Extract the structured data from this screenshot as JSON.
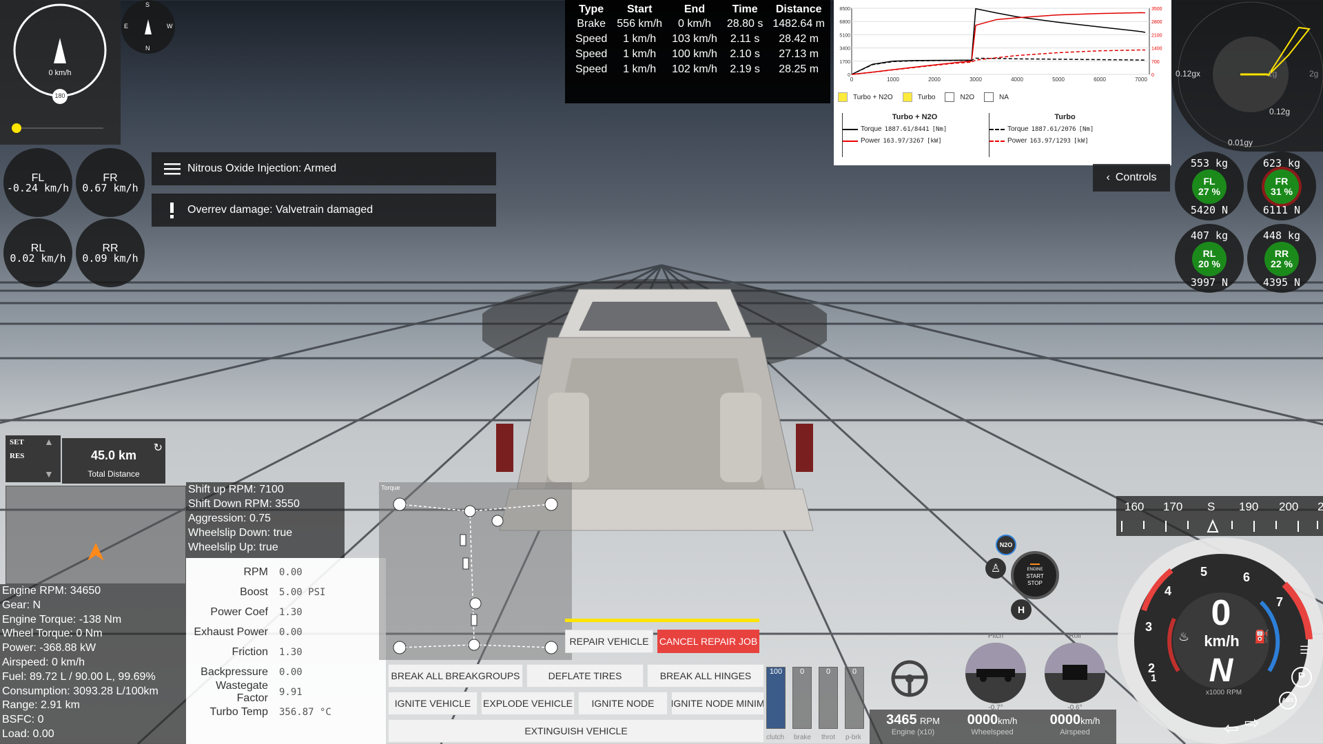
{
  "compass_gauge": {
    "speed": "0 km/h",
    "marker": "180",
    "dirs": {
      "s": "S",
      "e": "E",
      "w": "W",
      "n": "N"
    }
  },
  "wheel_speeds": [
    {
      "id": "FL",
      "label": "FL",
      "value": "-0.24 km/h"
    },
    {
      "id": "FR",
      "label": "FR",
      "value": "0.67 km/h"
    },
    {
      "id": "RL",
      "label": "RL",
      "value": "0.02 km/h"
    },
    {
      "id": "RR",
      "label": "RR",
      "value": "0.09 km/h"
    }
  ],
  "notifications": [
    {
      "text": "Nitrous Oxide Injection: Armed"
    },
    {
      "text": "Overrev damage: Valvetrain damaged"
    }
  ],
  "drag_table": {
    "headers": [
      "Type",
      "Start",
      "End",
      "Time",
      "Distance"
    ],
    "rows": [
      [
        "Brake",
        "556 km/h",
        "0 km/h",
        "28.80 s",
        "1482.64 m"
      ],
      [
        "Speed",
        "1 km/h",
        "103 km/h",
        "2.11 s",
        "28.42 m"
      ],
      [
        "Speed",
        "1 km/h",
        "100 km/h",
        "2.10 s",
        "27.13 m"
      ],
      [
        "Speed",
        "1 km/h",
        "102 km/h",
        "2.19 s",
        "28.25 m"
      ]
    ]
  },
  "chart_data": {
    "type": "line",
    "x": [
      0,
      500,
      1000,
      1500,
      2000,
      2500,
      2900,
      3000,
      3500,
      4000,
      5000,
      6000,
      7000,
      7100
    ],
    "x_ticks": [
      "0",
      "1000",
      "2000",
      "3000",
      "4000",
      "5000",
      "6000",
      "7000"
    ],
    "y_left_ticks": [
      "8500",
      "6800",
      "5100",
      "3400",
      "1700",
      "0"
    ],
    "y_right_ticks": [
      "3500",
      "2800",
      "2100",
      "1400",
      "700",
      "0"
    ],
    "series": [
      {
        "name": "Torque",
        "axis": "left",
        "color": "#000000",
        "dash": false,
        "values": [
          0,
          1300,
          1700,
          1780,
          1800,
          1820,
          1830,
          8441,
          7900,
          7400,
          6700,
          6100,
          5500,
          5400
        ]
      },
      {
        "name": "Power",
        "axis": "right",
        "color": "#e00000",
        "dash": false,
        "values": [
          0,
          120,
          250,
          380,
          500,
          620,
          700,
          2600,
          2900,
          3000,
          3150,
          3220,
          3267,
          3260
        ]
      },
      {
        "name": "Torque",
        "axis": "left",
        "color": "#000000",
        "dash": true,
        "values": [
          0,
          1250,
          1650,
          1740,
          1780,
          1800,
          1810,
          2076,
          2050,
          2000,
          1950,
          1900,
          1850,
          1840
        ]
      },
      {
        "name": "Power",
        "axis": "right",
        "color": "#e00000",
        "dash": true,
        "values": [
          0,
          110,
          240,
          360,
          480,
          590,
          650,
          760,
          880,
          1000,
          1150,
          1250,
          1293,
          1290
        ]
      }
    ],
    "checkboxes": [
      {
        "label": "Turbo + N2O",
        "checked": true
      },
      {
        "label": "Turbo",
        "checked": true
      },
      {
        "label": "N2O",
        "checked": false
      },
      {
        "label": "NA",
        "checked": false
      }
    ],
    "legend": [
      {
        "title": "Turbo + N2O",
        "torque_label": "Torque",
        "torque_val": "1887.61/8441",
        "torque_unit": "[Nm]",
        "power_label": "Power",
        "power_val": "163.97/3267",
        "power_unit": "[kW]"
      },
      {
        "title": "Turbo",
        "torque_label": "Torque",
        "torque_val": "1887.61/2076",
        "torque_unit": "[Nm]",
        "power_label": "Power",
        "power_val": "163.97/1293",
        "power_unit": "[kW]"
      }
    ]
  },
  "g_meter": {
    "x": "0.12gx",
    "y": "0.12g",
    "gy": "0.01gy",
    "ring1": "1g",
    "ring2": "2g"
  },
  "controls_label": "Controls",
  "tire_loads": [
    {
      "id": "FL",
      "kg": "553 kg",
      "pct": "27 %",
      "n": "5420 N"
    },
    {
      "id": "FR",
      "kg": "623 kg",
      "pct": "31 %",
      "n": "6111 N"
    },
    {
      "id": "RL",
      "kg": "407 kg",
      "pct": "20 %",
      "n": "3997 N"
    },
    {
      "id": "RR",
      "kg": "448 kg",
      "pct": "22 %",
      "n": "4395 N"
    }
  ],
  "cruise": {
    "set": "SET",
    "res": "RES",
    "distance": "45.0 km",
    "distance_label": "Total Distance"
  },
  "shift_info": [
    "Shift up RPM: 7100",
    "Shift Down RPM: 3550",
    "Aggression: 0.75",
    "Wheelslip Down: true",
    "Wheelslip Up: true"
  ],
  "engine_info": [
    "Engine RPM: 34650",
    "Gear: N",
    "Engine Torque: -138 Nm",
    "Wheel Torque: 0 Nm",
    "Power: -368.88 kW",
    "Airspeed: 0 km/h",
    "Fuel: 89.72 L / 90.00 L, 99.69%",
    "Consumption: 3093.28 L/100km",
    "Range: 2.91 km",
    "BSFC: 0",
    "Load: 0.00"
  ],
  "params": [
    {
      "label": "RPM",
      "value": "0.00"
    },
    {
      "label": "Boost",
      "value": "5.00 PSI"
    },
    {
      "label": "Power Coef",
      "value": "1.30"
    },
    {
      "label": "Exhaust Power",
      "value": "0.00"
    },
    {
      "label": "Friction",
      "value": "1.30"
    },
    {
      "label": "Backpressure",
      "value": "0.00"
    },
    {
      "label": "Wastegate Factor",
      "value": "9.91"
    },
    {
      "label": "Turbo Temp",
      "value": "356.87 °C"
    }
  ],
  "powertrain_label": "Torque",
  "buttons": {
    "repair": "REPAIR VEHICLE",
    "cancel_repair": "CANCEL REPAIR JOB",
    "break_breakgroups": "BREAK ALL BREAKGROUPS",
    "deflate": "DEFLATE TIRES",
    "break_hinges": "BREAK ALL HINGES",
    "ignite_vehicle": "IGNITE VEHICLE",
    "explode": "EXPLODE VEHICLE",
    "ignite_node": "IGNITE NODE",
    "ignite_node_min": "IGNITE NODE MINIM",
    "extinguish": "EXTINGUISH VEHICLE"
  },
  "pedals": [
    {
      "label": "clutch",
      "value": "100",
      "level": 1.0
    },
    {
      "label": "brake",
      "value": "0",
      "level": 0
    },
    {
      "label": "throt",
      "value": "0",
      "level": 0
    },
    {
      "label": "p-brk",
      "value": "0",
      "level": 0
    }
  ],
  "readouts": [
    {
      "value": "3465",
      "unit": "RPM",
      "label": "Engine (x10)"
    },
    {
      "value": "0000",
      "unit": "km/h",
      "label": "Wheelspeed"
    },
    {
      "value": "0000",
      "unit": "km/h",
      "label": "Airspeed"
    }
  ],
  "attitude": {
    "pitch_label": "Pitch",
    "pitch_val": "-0.7°",
    "roll_label": "Roll",
    "roll_val": "-0.6°"
  },
  "n2o_label": "N2O",
  "start_stop": {
    "l1": "ENGINE",
    "l2": "START",
    "l3": "STOP"
  },
  "heading_tape": [
    "160",
    "170",
    "S",
    "190",
    "200",
    "2"
  ],
  "speedo": {
    "speed": "0",
    "unit": "km/h",
    "gear": "N",
    "rpm_label": "x1000 RPM",
    "ticks": [
      "1",
      "2",
      "3",
      "4",
      "5",
      "6",
      "7"
    ],
    "p": "P",
    "abs": "ABS"
  }
}
